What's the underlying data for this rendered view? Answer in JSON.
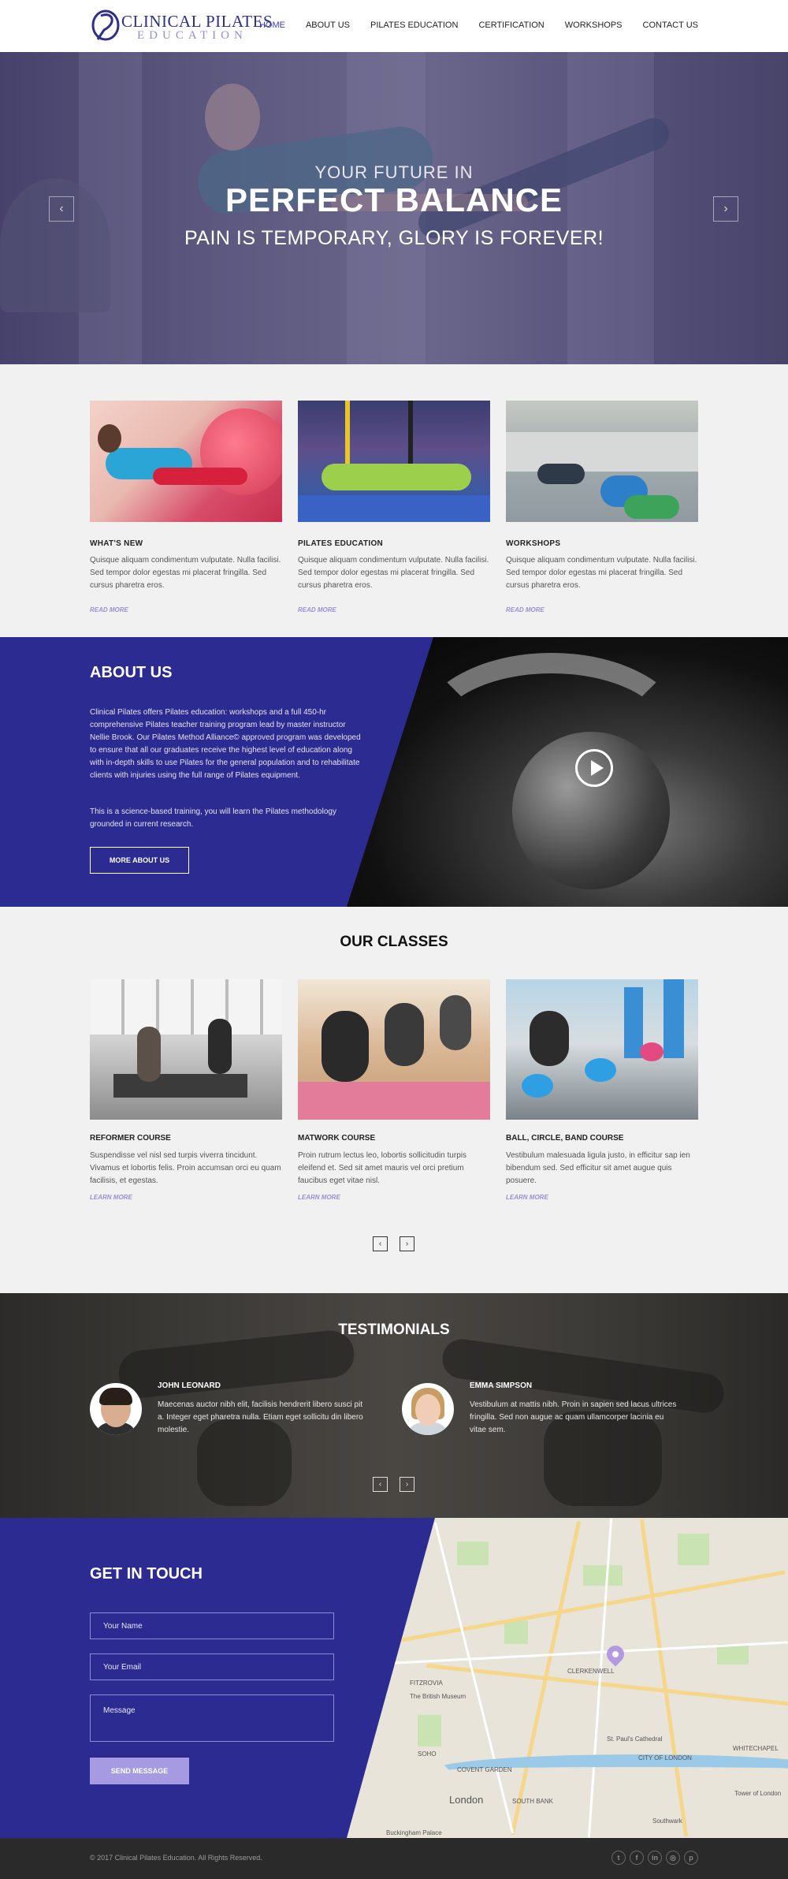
{
  "brand": {
    "line1": "CLINICAL PILATES",
    "line2": "EDUCATION"
  },
  "nav": [
    {
      "label": "HOME",
      "active": true
    },
    {
      "label": "ABOUT US"
    },
    {
      "label": "PILATES EDUCATION"
    },
    {
      "label": "CERTIFICATION"
    },
    {
      "label": "WORKSHOPS"
    },
    {
      "label": "CONTACT US"
    }
  ],
  "hero": {
    "subtitle": "YOUR FUTURE IN",
    "title": "PERFECT BALANCE",
    "tagline": "PAIN IS TEMPORARY, GLORY IS FOREVER!",
    "prev_icon": "‹",
    "next_icon": "›"
  },
  "features": [
    {
      "title": "WHAT'S NEW",
      "text": "Quisque aliquam condimentum vulputate. Nulla facilisi. Sed tempor dolor egestas mi placerat fringilla. Sed cursus pharetra eros.",
      "link": "READ MORE"
    },
    {
      "title": "PILATES EDUCATION",
      "text": "Quisque aliquam condimentum vulputate. Nulla facilisi. Sed tempor dolor egestas mi placerat fringilla. Sed cursus pharetra eros.",
      "link": "READ MORE"
    },
    {
      "title": "WORKSHOPS",
      "text": "Quisque aliquam condimentum vulputate. Nulla facilisi. Sed tempor dolor egestas mi placerat fringilla. Sed cursus pharetra eros.",
      "link": "READ MORE"
    }
  ],
  "about": {
    "title": "ABOUT US",
    "p1": "Clinical Pilates offers Pilates education: workshops and a full 450-hr comprehensive Pilates teacher training program lead by master instructor Nellie Brook. Our Pilates Method Alliance© approved program was developed to ensure that all our graduates receive the highest level of education along with in-depth skills to use Pilates for the general population and to rehabilitate clients with injuries using the full range of Pilates equipment.",
    "p2": "This is a science-based training, you will learn the Pilates methodology grounded in current research.",
    "button": "MORE ABOUT US"
  },
  "classes": {
    "title": "OUR CLASSES",
    "items": [
      {
        "title": "REFORMER COURSE",
        "text": "Suspendisse vel nisl sed turpis viverra tincidunt. Vivamus et lobortis felis. Proin accumsan orci eu quam facilisis, et egestas.",
        "link": "LEARN MORE"
      },
      {
        "title": "MATWORK COURSE",
        "text": "Proin rutrum lectus leo, lobortis sollicitudin turpis eleifend et. Sed sit amet mauris vel orci pretium faucibus eget vitae nisl.",
        "link": "LEARN MORE"
      },
      {
        "title": "BALL, CIRCLE, BAND COURSE",
        "text": "Vestibulum malesuada ligula justo, in efficitur sap ien bibendum sed. Sed efficitur sit amet augue quis posuere.",
        "link": "LEARN MORE"
      }
    ],
    "prev_icon": "‹",
    "next_icon": "›"
  },
  "testimonials": {
    "title": "TESTIMONIALS",
    "items": [
      {
        "name": "JOHN LEONARD",
        "text": "Maecenas auctor nibh elit, facilisis hendrerit libero susci pit a. Integer eget pharetra nulla. Etiam eget sollicitu din libero molestie."
      },
      {
        "name": "EMMA SIMPSON",
        "text": "Vestibulum at mattis nibh. Proin in sapien sed lacus ultrices fringilla. Sed non augue ac quam ullamcorper lacinia eu vitae sem."
      }
    ],
    "prev_icon": "‹",
    "next_icon": "›"
  },
  "contact": {
    "title": "GET IN TOUCH",
    "name_placeholder": "Your Name",
    "email_placeholder": "Your Email",
    "message_placeholder": "Message",
    "button": "SEND MESSAGE",
    "map_labels": {
      "clerkenwell": "CLERKENWELL",
      "fitzrovia": "FITZROVIA",
      "british_museum": "The British Museum",
      "soho": "SOHO",
      "covent_garden": "COVENT GARDEN",
      "st_pauls": "St. Paul's Cathedral",
      "city": "CITY OF LONDON",
      "london": "London",
      "whitechapel": "WHITECHAPEL",
      "south_bank": "SOUTH BANK",
      "tower": "Tower of London",
      "southwark": "Southwark",
      "buckingham": "Buckingham Palace"
    }
  },
  "footer": {
    "copyright": "© 2017 Clinical Pilates Education. All Rights Reserved.",
    "socials": [
      "twitter-icon",
      "facebook-icon",
      "linkedin-icon",
      "instagram-icon",
      "pinterest-icon"
    ],
    "social_glyphs": [
      "t",
      "f",
      "in",
      "◎",
      "p"
    ]
  },
  "colors": {
    "primary": "#2b2b92",
    "accent": "#9b8fd6",
    "nav_active": "#3b3dbd",
    "footer": "#2a2a2a"
  }
}
